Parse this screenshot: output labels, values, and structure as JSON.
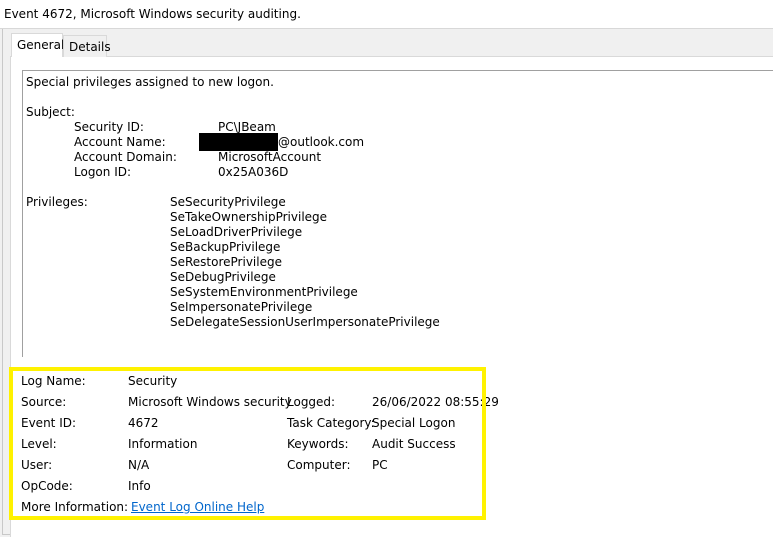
{
  "window": {
    "title": "Event 4672, Microsoft Windows security auditing."
  },
  "tabs": [
    {
      "label": "General",
      "selected": true
    },
    {
      "label": "Details",
      "selected": false
    }
  ],
  "message": {
    "intro": "Special privileges assigned to new logon.",
    "subject_heading": "Subject:",
    "subject": [
      {
        "label": "Security ID:",
        "value": "PC\\JBeam"
      },
      {
        "label": "Account Name:",
        "value": "@outlook.com"
      },
      {
        "label": "Account Domain:",
        "value": "MicrosoftAccount"
      },
      {
        "label": "Logon ID:",
        "value": "0x25A036D"
      }
    ],
    "privileges_heading": "Privileges:",
    "privileges": [
      "SeSecurityPrivilege",
      "SeTakeOwnershipPrivilege",
      "SeLoadDriverPrivilege",
      "SeBackupPrivilege",
      "SeRestorePrivilege",
      "SeDebugPrivilege",
      "SeSystemEnvironmentPrivilege",
      "SeImpersonatePrivilege",
      "SeDelegateSessionUserImpersonatePrivilege"
    ]
  },
  "details": {
    "log_name": {
      "label": "Log Name:",
      "value": "Security"
    },
    "source": {
      "label": "Source:",
      "value": "Microsoft Windows security"
    },
    "logged": {
      "label": "Logged:",
      "value": "26/06/2022 08:55:29"
    },
    "event_id": {
      "label": "Event ID:",
      "value": "4672"
    },
    "task_category": {
      "label": "Task Category:",
      "value": "Special Logon"
    },
    "level": {
      "label": "Level:",
      "value": "Information"
    },
    "keywords": {
      "label": "Keywords:",
      "value": "Audit Success"
    },
    "user": {
      "label": "User:",
      "value": "N/A"
    },
    "computer": {
      "label": "Computer:",
      "value": "PC"
    },
    "opcode": {
      "label": "OpCode:",
      "value": "Info"
    },
    "more_info": {
      "label": "More Information:",
      "link": "Event Log Online Help"
    }
  },
  "colors": {
    "highlight": "#fff200",
    "link": "#0066cc",
    "redaction": "#000000"
  }
}
